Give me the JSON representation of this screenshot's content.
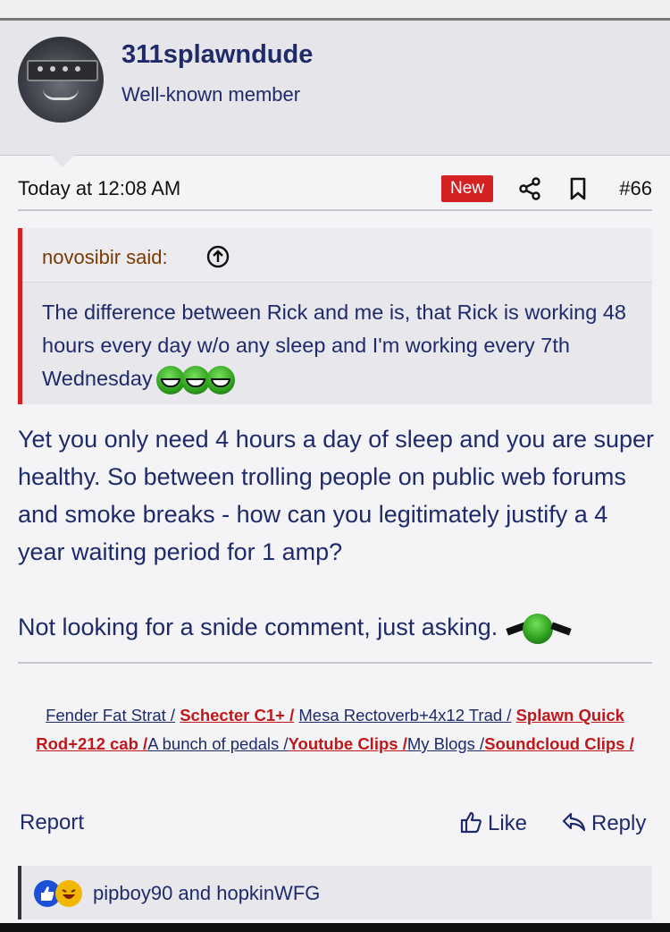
{
  "user": {
    "username": "311splawndude",
    "title": "Well-known member"
  },
  "post": {
    "date": "Today at 12:08 AM",
    "new_badge": "New",
    "number": "#66"
  },
  "quote": {
    "author": "novosibir said:",
    "text": "The difference between Rick and me is, that Rick is working 48 hours every day w/o any sleep and I'm working every 7th Wednesday"
  },
  "body": {
    "paragraph1": "Yet you only need 4 hours a day of sleep and you are super healthy. So between trolling people on public web forums and smoke breaks - how can you legitimately justify a 4 year waiting period for 1 amp?",
    "paragraph2": "Not looking for a snide comment, just asking."
  },
  "signature": {
    "items": [
      "Fender Fat Strat /",
      "Schecter C1+ /",
      "Mesa Rectoverb+4x12 Trad /",
      "Splawn Quick Rod+212 cab /",
      "A bunch of pedals /",
      "Youtube Clips /",
      "My Blogs /",
      "Soundcloud Clips /"
    ]
  },
  "actions": {
    "report": "Report",
    "like": "Like",
    "reply": "Reply"
  },
  "reactions": {
    "users": "pipboy90 and hopkinWFG"
  },
  "colors": {
    "accent_red": "#d42222",
    "link_blue": "#1f2a6b",
    "header_bg": "#e6e6ea"
  }
}
